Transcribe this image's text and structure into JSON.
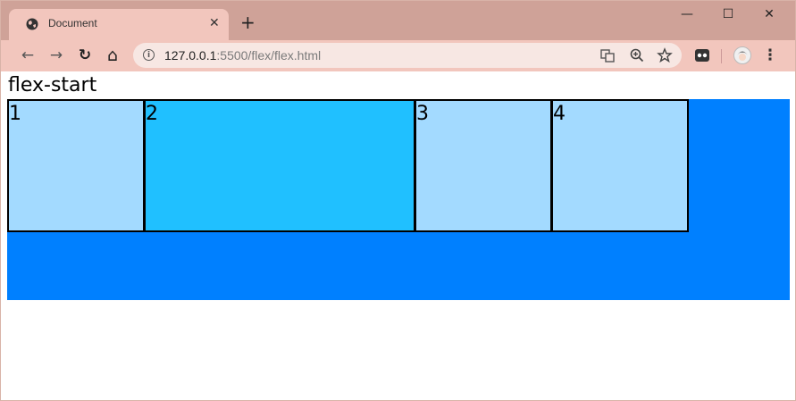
{
  "browser": {
    "tab": {
      "title": "Document",
      "close_label": "✕"
    },
    "new_tab_label": "+",
    "window_controls": {
      "minimize": "—",
      "maximize": "☐",
      "close": "✕"
    },
    "nav": {
      "back": "←",
      "forward": "→",
      "reload": "↻",
      "home": "⌂"
    },
    "url": {
      "host": "127.0.0.1",
      "rest": ":5500/flex/flex.html"
    },
    "omnibox_icons": [
      "translate-icon",
      "zoom-icon",
      "star-icon"
    ],
    "menu_label": "⋮"
  },
  "page": {
    "heading": "flex-start",
    "items": [
      {
        "label": "1",
        "color": "#a3daff"
      },
      {
        "label": "2",
        "color": "#20c0ff"
      },
      {
        "label": "3",
        "color": "#a3daff"
      },
      {
        "label": "4",
        "color": "#a3daff"
      }
    ],
    "container_color": "#0080ff"
  },
  "colors": {
    "titlebar": "#cfa298",
    "tab_active": "#f2c6bd",
    "toolbar": "#f2c6bd"
  }
}
